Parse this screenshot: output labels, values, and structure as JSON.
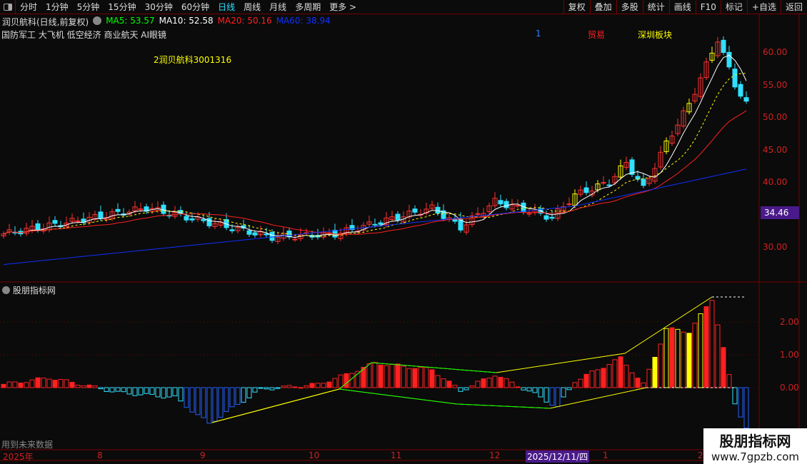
{
  "toolbar": {
    "periods": [
      "分时",
      "1分钟",
      "5分钟",
      "15分钟",
      "30分钟",
      "60分钟",
      "日线",
      "周线",
      "月线",
      "多周期",
      "更多 >"
    ],
    "active": "日线",
    "right": [
      "复权",
      "叠加",
      "多股",
      "统计",
      "画线",
      "F10",
      "标记",
      "+自选",
      "返回"
    ]
  },
  "stock": {
    "title": "润贝航科(日线,前复权)",
    "ma5": "MA5: 53.57",
    "ma10": "MA10: 52.58",
    "ma20": "MA20: 50.16",
    "ma60": "MA60: 38.94",
    "tags": "国防军工 大飞机 低空经济 商业航天 AI眼镜",
    "note1": "1",
    "note2": "贸易",
    "note3": "深圳板块",
    "label": "2润贝航科3001316",
    "last_price": "34.46"
  },
  "colors": {
    "up": "#ff3030",
    "down": "#30e0ff",
    "ma5": "#ffffff",
    "ma10": "#ffff00",
    "ma20": "#ff2020",
    "ma60": "#1030ff"
  },
  "price_axis": [
    "60.00",
    "55.00",
    "50.00",
    "45.00",
    "40.00",
    "35.00",
    "30.00"
  ],
  "indicator": {
    "name": "股朋指标网",
    "axis": [
      "2.00",
      "1.00",
      "0.00"
    ],
    "footer": "用到未来数据"
  },
  "dates": {
    "labels": [
      "2025年",
      "8",
      "9",
      "10",
      "11",
      "12",
      "1",
      "2"
    ],
    "cursor": "2025/12/11/四"
  },
  "watermark": {
    "title": "股朋指标网",
    "url": "www.7gpzb.com"
  },
  "chart_data": {
    "type": "candlestick",
    "close_keypoints": [
      [
        0,
        32
      ],
      [
        25,
        36
      ],
      [
        47,
        31.5
      ],
      [
        58,
        32
      ],
      [
        75,
        36
      ],
      [
        80,
        33
      ],
      [
        86,
        37
      ],
      [
        96,
        34.5
      ],
      [
        100,
        38
      ],
      [
        106,
        40
      ],
      [
        109,
        43
      ],
      [
        112,
        39
      ],
      [
        116,
        46
      ],
      [
        120,
        52
      ],
      [
        124,
        60
      ],
      [
        125,
        62
      ],
      [
        128,
        55
      ],
      [
        130,
        52
      ]
    ],
    "indicator_keypoints": [
      [
        0,
        0.1
      ],
      [
        8,
        0.3
      ],
      [
        15,
        0.05
      ],
      [
        20,
        -0.15
      ],
      [
        30,
        -0.3
      ],
      [
        36,
        -1.1
      ],
      [
        45,
        -0.05
      ],
      [
        55,
        0.1
      ],
      [
        60,
        0.4
      ],
      [
        65,
        0.75
      ],
      [
        75,
        0.55
      ],
      [
        80,
        -0.1
      ],
      [
        86,
        0.4
      ],
      [
        93,
        -0.2
      ],
      [
        97,
        -0.6
      ],
      [
        100,
        0.2
      ],
      [
        108,
        0.9
      ],
      [
        112,
        0.1
      ],
      [
        116,
        1.8
      ],
      [
        120,
        1.7
      ],
      [
        124,
        2.7
      ],
      [
        126,
        1.2
      ],
      [
        128,
        -0.5
      ],
      [
        130,
        -1.2
      ]
    ]
  }
}
